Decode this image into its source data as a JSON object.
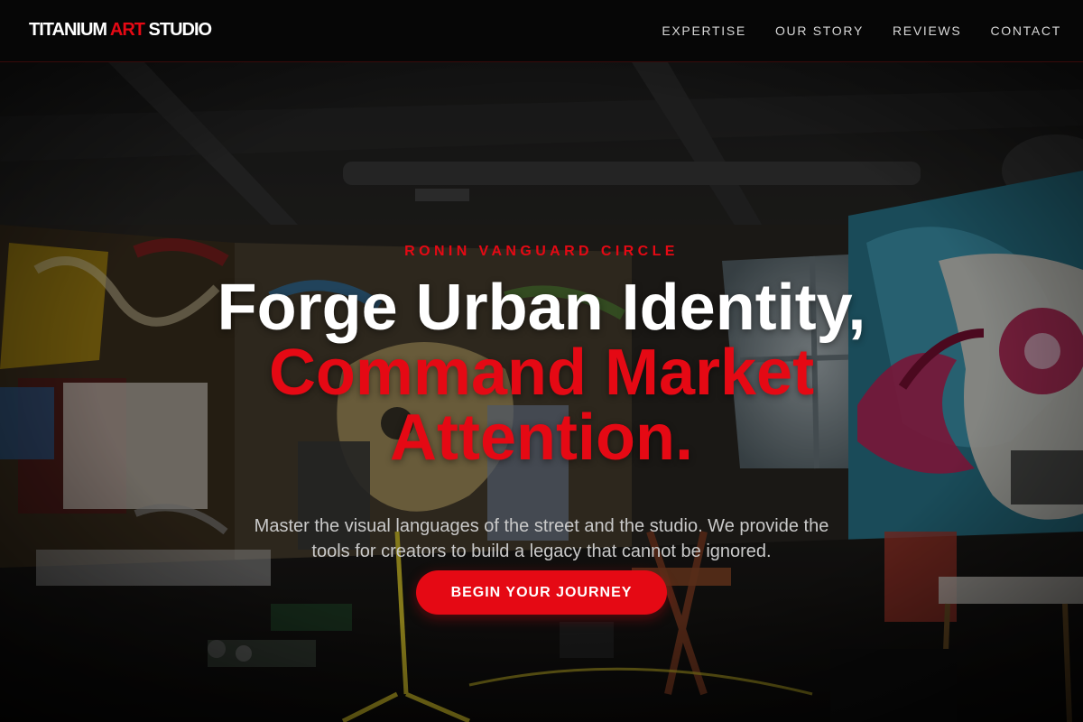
{
  "header": {
    "brand": {
      "part1": "TITANIUM ",
      "part2": "ART",
      "part3": " STUDIO"
    },
    "nav": [
      {
        "label": "EXPERTISE"
      },
      {
        "label": "OUR STORY"
      },
      {
        "label": "REVIEWS"
      },
      {
        "label": "CONTACT"
      }
    ]
  },
  "hero": {
    "eyebrow": "RONIN VANGUARD CIRCLE",
    "headline_white": "Forge Urban Identity,",
    "headline_red_1": "Command Market",
    "headline_red_2": "Attention.",
    "subtext": "Master the visual languages of the street and the studio. We provide the tools for creators to build a legacy that cannot be ignored.",
    "cta_label": "BEGIN YOUR JOURNEY"
  },
  "colors": {
    "accent": "#e50914",
    "header_bg": "#060606",
    "text_primary": "#ffffff",
    "text_muted": "#c9c9c9"
  }
}
